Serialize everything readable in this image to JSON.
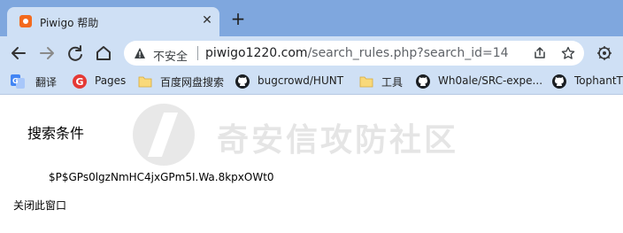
{
  "browser": {
    "tab": {
      "title": "Piwigo 帮助",
      "close_glyph": "✕"
    },
    "new_tab_glyph": "+",
    "address": {
      "security_label": "不安全",
      "url_host": "piwigo1220.com",
      "url_rest": "/search_rules.php?search_id=14"
    },
    "bookmarks": [
      {
        "label": "翻译",
        "icon": "google-translate-icon"
      },
      {
        "label": "Pages",
        "icon": "pages-icon"
      },
      {
        "label": "百度网盘搜索",
        "icon": "folder-icon"
      },
      {
        "label": "bugcrowd/HUNT",
        "icon": "github-icon"
      },
      {
        "label": "工具",
        "icon": "folder-icon"
      },
      {
        "label": "Wh0ale/SRC-expe...",
        "icon": "github-icon"
      },
      {
        "label": "TophantT",
        "icon": "github-icon"
      }
    ]
  },
  "page": {
    "watermark": "奇安信攻防社区",
    "heading": "搜索条件",
    "rule_value": "$P$GPs0lgzNmHC4jxGPm5I.Wa.8kpxOWt0",
    "close_window_label": "关闭此窗口"
  },
  "colors": {
    "tab_strip": "#7fa7de",
    "toolbar": "#cfe0f5",
    "favicon": "#f36a1e"
  }
}
